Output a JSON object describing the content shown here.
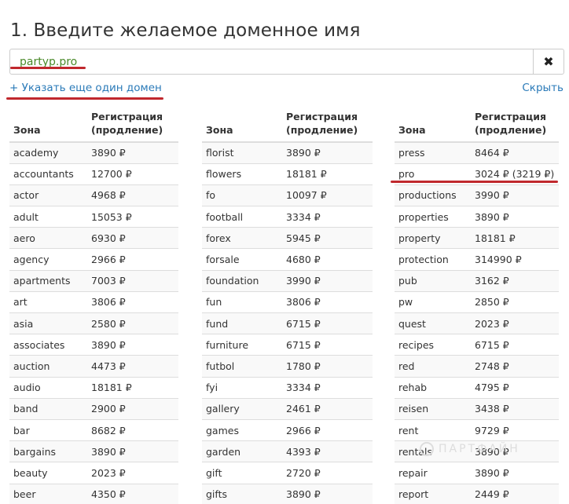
{
  "title": "1. Введите желаемое доменное имя",
  "domain_input": {
    "value": "partyp.pro"
  },
  "clear_button": {
    "label": "✖"
  },
  "add_domain_link": "+ Указать еще один домен",
  "hide_link": "Скрыть",
  "table_headers": {
    "zone": "Зона",
    "reg_line1": "Регистрация",
    "reg_line2": "(продление)"
  },
  "columns": [
    [
      {
        "zone": "academy",
        "price": "3890 ₽"
      },
      {
        "zone": "accountants",
        "price": "12700 ₽"
      },
      {
        "zone": "actor",
        "price": "4968 ₽"
      },
      {
        "zone": "adult",
        "price": "15053 ₽"
      },
      {
        "zone": "aero",
        "price": "6930 ₽"
      },
      {
        "zone": "agency",
        "price": "2966 ₽"
      },
      {
        "zone": "apartments",
        "price": "7003 ₽"
      },
      {
        "zone": "art",
        "price": "3806 ₽"
      },
      {
        "zone": "asia",
        "price": "2580 ₽"
      },
      {
        "zone": "associates",
        "price": "3890 ₽"
      },
      {
        "zone": "auction",
        "price": "4473 ₽"
      },
      {
        "zone": "audio",
        "price": "18181 ₽"
      },
      {
        "zone": "band",
        "price": "2900 ₽"
      },
      {
        "zone": "bar",
        "price": "8682 ₽"
      },
      {
        "zone": "bargains",
        "price": "3890 ₽"
      },
      {
        "zone": "beauty",
        "price": "2023 ₽"
      },
      {
        "zone": "beer",
        "price": "4350 ₽"
      }
    ],
    [
      {
        "zone": "florist",
        "price": "3890 ₽"
      },
      {
        "zone": "flowers",
        "price": "18181 ₽"
      },
      {
        "zone": "fo",
        "price": "10097 ₽"
      },
      {
        "zone": "football",
        "price": "3334 ₽"
      },
      {
        "zone": "forex",
        "price": "5945 ₽"
      },
      {
        "zone": "forsale",
        "price": "4680 ₽"
      },
      {
        "zone": "foundation",
        "price": "3990 ₽"
      },
      {
        "zone": "fun",
        "price": "3806 ₽"
      },
      {
        "zone": "fund",
        "price": "6715 ₽"
      },
      {
        "zone": "furniture",
        "price": "6715 ₽"
      },
      {
        "zone": "futbol",
        "price": "1780 ₽"
      },
      {
        "zone": "fyi",
        "price": "3334 ₽"
      },
      {
        "zone": "gallery",
        "price": "2461 ₽"
      },
      {
        "zone": "games",
        "price": "2966 ₽"
      },
      {
        "zone": "garden",
        "price": "4393 ₽"
      },
      {
        "zone": "gift",
        "price": "2720 ₽"
      },
      {
        "zone": "gifts",
        "price": "3890 ₽"
      }
    ],
    [
      {
        "zone": "press",
        "price": "8464 ₽"
      },
      {
        "zone": "pro",
        "price": "3024 ₽ (3219 ₽)"
      },
      {
        "zone": "productions",
        "price": "3990 ₽"
      },
      {
        "zone": "properties",
        "price": "3890 ₽"
      },
      {
        "zone": "property",
        "price": "18181 ₽"
      },
      {
        "zone": "protection",
        "price": "314990 ₽"
      },
      {
        "zone": "pub",
        "price": "3162 ₽"
      },
      {
        "zone": "pw",
        "price": "2850 ₽"
      },
      {
        "zone": "quest",
        "price": "2023 ₽"
      },
      {
        "zone": "recipes",
        "price": "6715 ₽"
      },
      {
        "zone": "red",
        "price": "2748 ₽"
      },
      {
        "zone": "rehab",
        "price": "4795 ₽"
      },
      {
        "zone": "reisen",
        "price": "3438 ₽"
      },
      {
        "zone": "rent",
        "price": "9729 ₽"
      },
      {
        "zone": "rentals",
        "price": "3890 ₽"
      },
      {
        "zone": "repair",
        "price": "3890 ₽"
      },
      {
        "zone": "report",
        "price": "2449 ₽"
      }
    ]
  ],
  "watermark": "ПАРТФАЙН",
  "colors": {
    "link": "#2a7ab8",
    "annotation": "#c0282d",
    "input_text": "#4a8a2a",
    "stripe": "#f9f9f9"
  }
}
